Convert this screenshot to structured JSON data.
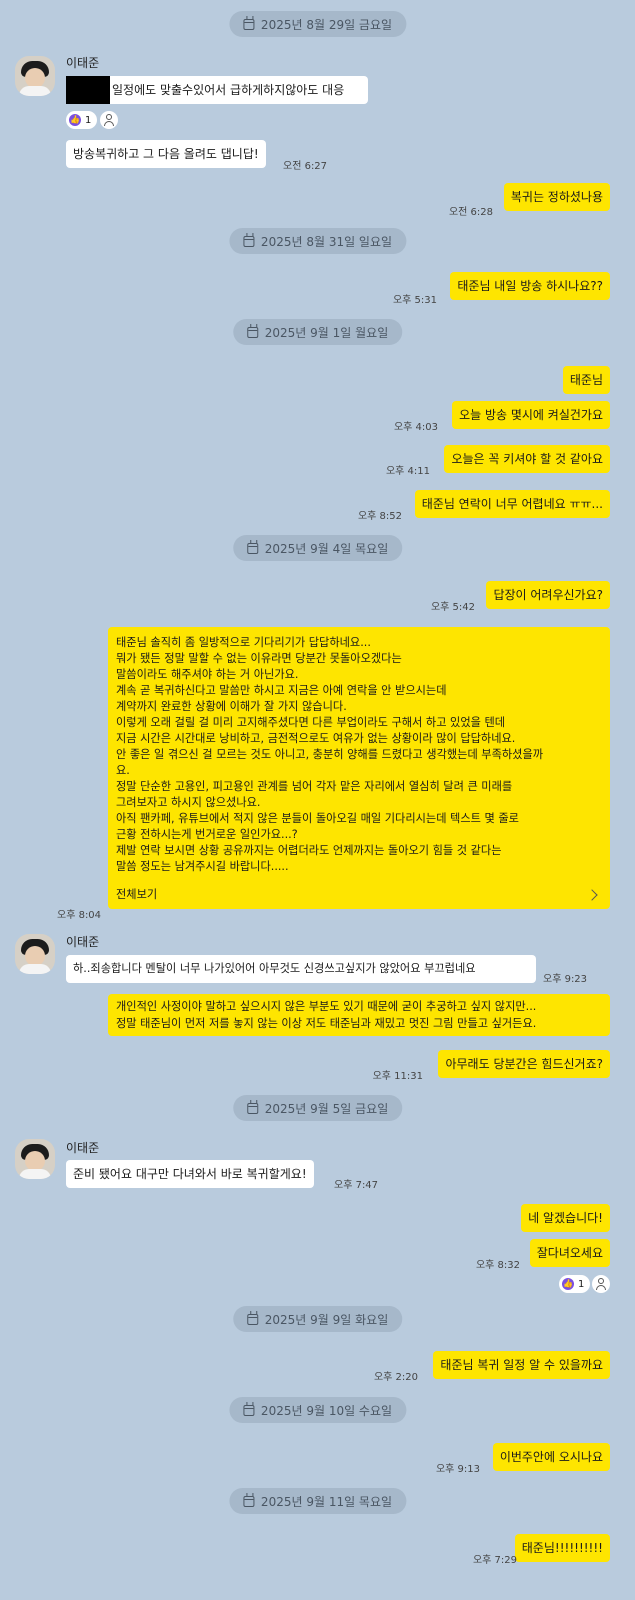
{
  "dates": [
    "2025년 8월 29일 금요일",
    "2025년 8월 31일 일요일",
    "2025년 9월 1일 월요일",
    "2025년 9월 4일 목요일",
    "2025년 9월 5일 금요일",
    "2025년 9월 9일 화요일",
    "2025년 9월 10일 수요일",
    "2025년 9월 11일 목요일"
  ],
  "sender_name": "이태준",
  "messages": {
    "m1": "일정에도 맞출수있어서 급하게하지않아도 대응",
    "m1_reaction": "1",
    "m2": "방송복귀하고 그 다음 올려도 댑니답!",
    "m2_time": "오전 6:27",
    "m3": "복귀는 정하셨나용",
    "m3_time": "오전 6:28",
    "m4": "태준님 내일 방송 하시나요??",
    "m4_time": "오후 5:31",
    "m5": "태준님",
    "m6": "오늘 방송 몇시에 켜실건가요",
    "m6_time": "오후 4:03",
    "m7": "오늘은 꼭 키셔야 할 것 같아요",
    "m7_time": "오후 4:11",
    "m8": "태준님 연락이 너무 어렵네요 ㅠㅠ...",
    "m8_time": "오후 8:52",
    "m9": "답장이 어려우신가요?",
    "m9_time": "오후 5:42",
    "long_lines": [
      "태준님 솔직히 좀 일방적으로 기다리기가 답답하네요...",
      "뭐가 됐든 정말 말할 수 없는 이유라면 당분간 못돌아오겠다는",
      "말씀이라도 해주셔야 하는 거 아닌가요.",
      "계속 곧 복귀하신다고 말씀만 하시고 지금은 아예 연락을 안 받으시는데",
      "계약까지 완료한 상황에 이해가 잘 가지 않습니다.",
      "이렇게 오래 걸릴 걸 미리 고지해주셨다면 다른 부업이라도 구해서 하고 있었을 텐데",
      "지금 시간은 시간대로 낭비하고, 금전적으로도 여유가 없는 상황이라 많이 답답하네요.",
      "안 좋은 일 겪으신 걸 모르는 것도 아니고, 충분히 양해를 드렸다고 생각했는데 부족하셨을까",
      "요.",
      "정말 단순한 고용인, 피고용인 관계를 넘어 각자 맡은 자리에서 열심히 달려 큰 미래를",
      "그려보자고 하시지 않으셨나요.",
      "아직 팬카페, 유튜브에서 적지 않은 분들이 돌아오길 매일 기다리시는데 텍스트 몇 줄로",
      "근황 전하시는게 번거로운 일인가요...?",
      "제발 연락 보시면 상황 공유까지는 어렵더라도 언제까지는 돌아오기 힘들 것 같다는",
      "말씀 정도는 남겨주시길 바랍니다....."
    ],
    "long_more": "전체보기",
    "long_time": "오후 8:04",
    "m10": "하..죄송합니다 멘탈이 너무 나가있어어 아무것도 신경쓰고싶지가 않았어요 부끄럽네요",
    "m10_time": "오후 9:23",
    "m11_line1": "개인적인 사정이야 말하고 싶으시지 않은 부분도 있기 때문에 굳이 추궁하고 싶지 않지만...",
    "m11_line2": "정말 태준님이 먼저 저를 놓지 않는 이상 저도 태준님과 재밌고 멋진 그림 만들고 싶거든요.",
    "m12": "아무래도 당분간은 힘드신거죠?",
    "m12_time": "오후 11:31",
    "m13": "준비 됐어요 대구만 다녀와서 바로 복귀할게요!",
    "m13_time": "오후 7:47",
    "m14": "네 알겠습니다!",
    "m15": "잘다녀오세요",
    "m15_time": "오후 8:32",
    "m15_reaction": "1",
    "m16": "태준님 복귀 일정 알 수 있을까요",
    "m16_time": "오후 2:20",
    "m17": "이번주안에 오시나요",
    "m17_time": "오후 9:13",
    "m18": "태준님!!!!!!!!!!",
    "m18_time": "오후 7:29"
  },
  "colors": {
    "background": "#b9cbdd",
    "my_bubble": "#fee500",
    "other_bubble": "#ffffff",
    "reaction_accent": "#7b4fe0"
  },
  "icons": [
    "calendar-icon",
    "thumbs-up-icon",
    "person-icon",
    "chevron-right-icon"
  ]
}
